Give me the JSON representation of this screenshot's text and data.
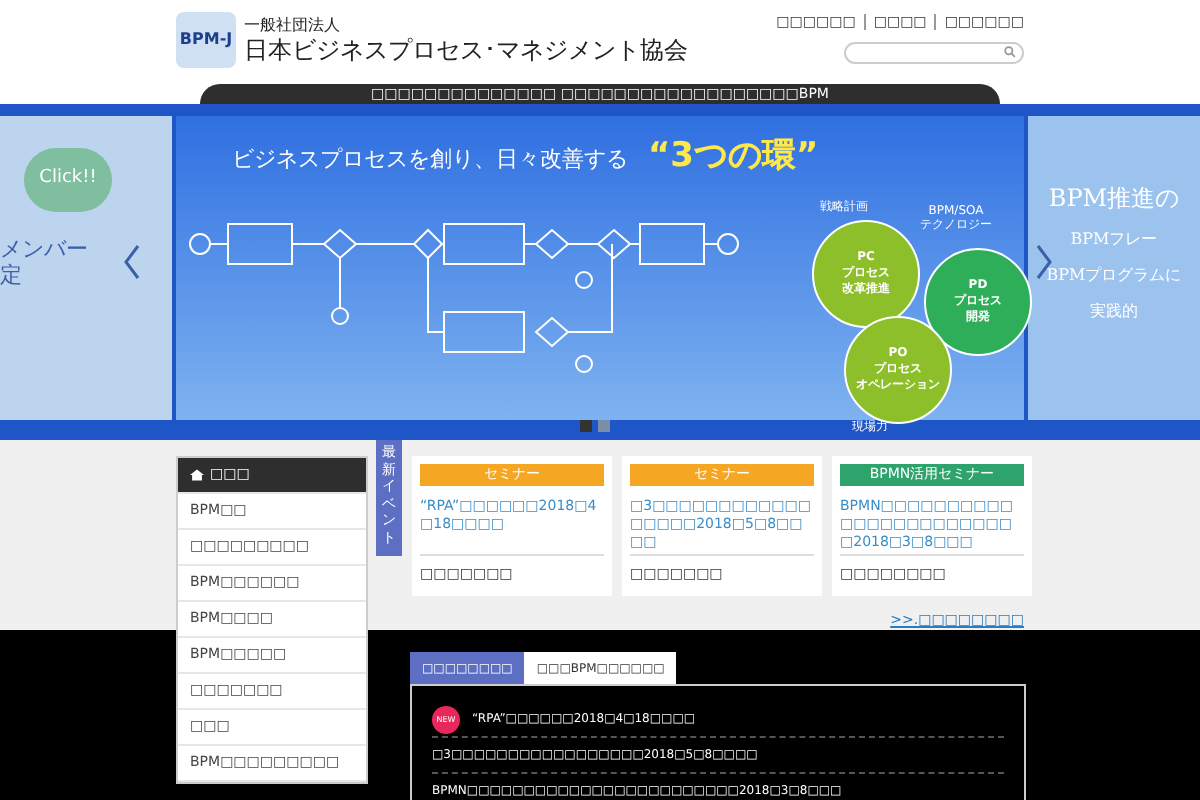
{
  "header": {
    "org_type": "一般社団法人",
    "org_name": "日本ビジネスプロセス･マネジメント協会",
    "logo": "BPM-J",
    "links": [
      "□□□□□□",
      "□□□□",
      "□□□□□□"
    ]
  },
  "tagline": "□□□□□□□□□□□□□□ □□□□□□□□□□□□□□□□□□BPM",
  "banner": {
    "headline": "ビジネスプロセスを創り、日々改善する",
    "highlight": "“3つの環”",
    "rings": [
      {
        "lines": [
          "PC",
          "プロセス",
          "改革推進"
        ],
        "color": "#8cbf2a"
      },
      {
        "lines": [
          "PD",
          "プロセス",
          "開発"
        ],
        "color": "#2fae5a"
      },
      {
        "lines": [
          "PO",
          "プロセス",
          "オペレーション"
        ],
        "color": "#8cbf2a"
      }
    ],
    "ring_captions": [
      "戦略計画",
      "BPM/SOA\nテクノロジー",
      "現場力"
    ],
    "left_peek": {
      "bubble": "Click!!",
      "lines": [
        "メンバー",
        "定"
      ]
    },
    "right_peek": {
      "title": "BPM推進の",
      "lines": [
        "BPMフレー",
        "BPMプログラムに",
        "実践的"
      ]
    },
    "dots": [
      {
        "selected": true
      },
      {
        "selected": false
      }
    ]
  },
  "side_menu": [
    {
      "label": "□□□",
      "kind": "home",
      "selected": true
    },
    {
      "label": "BPM□□",
      "kind": "item",
      "selected": false
    },
    {
      "label": "□□□□□□□□□",
      "kind": "item",
      "selected": false
    },
    {
      "label": "BPM□□□□□□",
      "kind": "item",
      "selected": false
    },
    {
      "label": "BPM□□□□",
      "kind": "item",
      "selected": false
    },
    {
      "label": "BPM□□□□□",
      "kind": "item",
      "selected": false
    },
    {
      "label": "□□□□□□□",
      "kind": "item",
      "selected": false
    },
    {
      "label": "□□□",
      "kind": "item",
      "selected": false
    },
    {
      "label": "BPM□□□□□□□□□",
      "kind": "item",
      "selected": false
    }
  ],
  "events_tab": "最新イベント",
  "events": [
    {
      "category": "セミナー",
      "color": "#f5a623",
      "title": "“RPA”□□□□□□2018□4□18□□□□",
      "footer": "□□□□□□□"
    },
    {
      "category": "セミナー",
      "color": "#f5a623",
      "title": "□3□□□□□□□□□□□□□□□□□2018□5□8□□□□",
      "footer": "□□□□□□□"
    },
    {
      "category": "BPMN活用セミナー",
      "color": "#2ea36b",
      "title": "BPMN□□□□□□□□□□□□□□□□□□□□□□□□2018□3□8□□□",
      "footer": "□□□□□□□□"
    }
  ],
  "events_more": ">>.□□□□□□□□",
  "news_tabs": [
    {
      "label": "□□□□□□□□",
      "selected": true
    },
    {
      "label": "□□□BPM□□□□□□",
      "selected": false
    }
  ],
  "news": [
    {
      "text": "“RPA”□□□□□□2018□4□18□□□□",
      "new": true
    },
    {
      "text": "□3□□□□□□□□□□□□□□□□□2018□5□8□□□□",
      "new": false
    },
    {
      "text": "BPMN□□□□□□□□□□□□□□□□□□□□□□□□2018□3□8□□□",
      "new": false
    }
  ],
  "new_badge": "NEW"
}
